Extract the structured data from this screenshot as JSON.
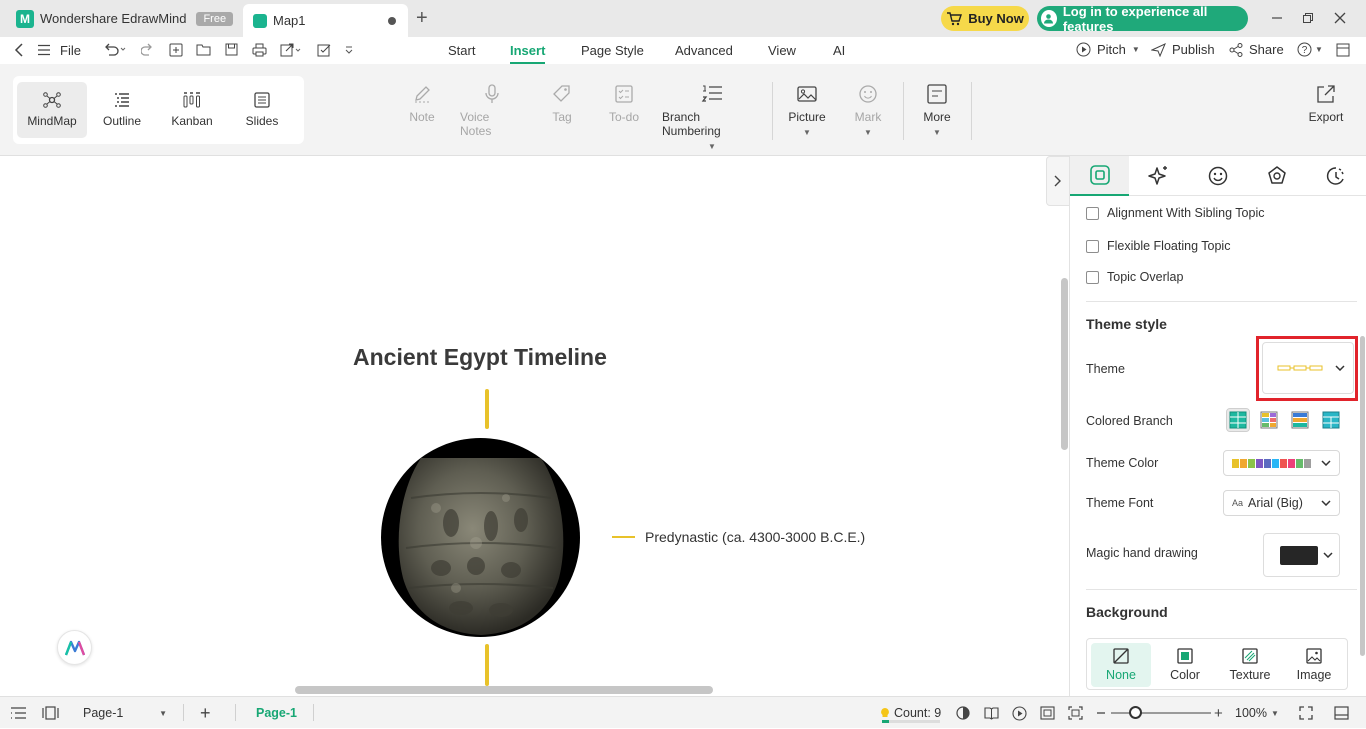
{
  "app": {
    "name": "Wondershare EdrawMind",
    "badge": "Free"
  },
  "document_tab": {
    "title": "Map1"
  },
  "header_buttons": {
    "buy_now": "Buy Now",
    "login": "Log in to experience all features"
  },
  "menu": {
    "file": "File",
    "tabs": [
      "Start",
      "Insert",
      "Page Style",
      "Advanced",
      "View",
      "AI"
    ],
    "active_tab": "Insert",
    "right": {
      "pitch": "Pitch",
      "publish": "Publish",
      "share": "Share"
    }
  },
  "view_modes": [
    {
      "label": "MindMap",
      "icon": "mindmap-icon",
      "selected": true
    },
    {
      "label": "Outline",
      "icon": "outline-icon",
      "selected": false
    },
    {
      "label": "Kanban",
      "icon": "kanban-icon",
      "selected": false
    },
    {
      "label": "Slides",
      "icon": "slides-icon",
      "selected": false
    }
  ],
  "ribbon": {
    "note": "Note",
    "voice_notes": "Voice Notes",
    "tag": "Tag",
    "todo": "To-do",
    "branch_numbering": "Branch Numbering",
    "picture": "Picture",
    "mark": "Mark",
    "more": "More",
    "export": "Export"
  },
  "canvas": {
    "main_topic": "Ancient Egypt Timeline",
    "subtopic": "Predynastic (ca. 4300-3000 B.C.E.)"
  },
  "panel": {
    "options": [
      {
        "label": "Alignment With Sibling Topic",
        "checked": false
      },
      {
        "label": "Flexible Floating Topic",
        "checked": false
      },
      {
        "label": "Topic Overlap",
        "checked": false
      }
    ],
    "theme_style": {
      "heading": "Theme style",
      "theme_label": "Theme",
      "colored_branch_label": "Colored Branch",
      "theme_color_label": "Theme Color",
      "theme_font_label": "Theme Font",
      "theme_font_value": "Arial (Big)",
      "magic_hand_label": "Magic hand drawing"
    },
    "background": {
      "heading": "Background",
      "options": [
        {
          "label": "None",
          "selected": true
        },
        {
          "label": "Color",
          "selected": false
        },
        {
          "label": "Texture",
          "selected": false
        },
        {
          "label": "Image",
          "selected": false
        }
      ]
    }
  },
  "colors": {
    "accent": "#17a774",
    "branch": "#e8c22a",
    "highlight": "#e1232b",
    "theme_swatches": [
      "#e8c22a",
      "#f0a830",
      "#8bc34a",
      "#7e57c2",
      "#5c6bc0",
      "#29b6f6",
      "#ef5350",
      "#ec407a",
      "#66bb6a",
      "#9e9e9e"
    ]
  },
  "status_bar": {
    "page_select": "Page-1",
    "page_tab": "Page-1",
    "count": "Count: 9",
    "zoom": "100%"
  }
}
